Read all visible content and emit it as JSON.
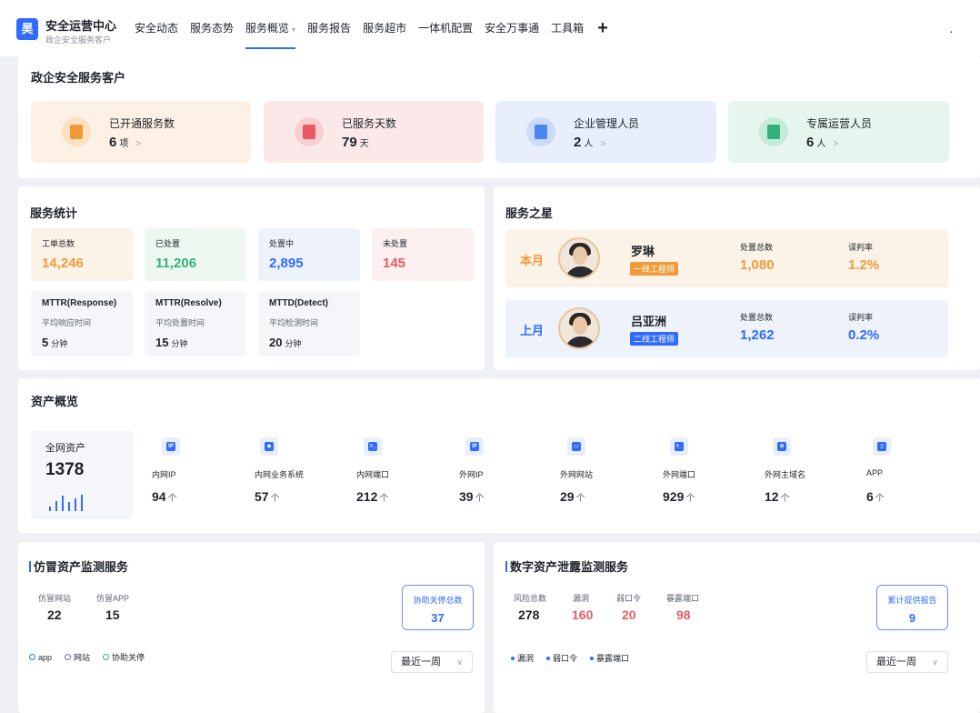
{
  "app": {
    "logo_char": "昊",
    "title": "安全运营中心",
    "subtitle": "政企安全服务客户"
  },
  "nav": {
    "items": [
      "安全动态",
      "服务态势",
      "服务概览",
      "服务报告",
      "服务超市",
      "一体机配置",
      "安全万事通",
      "工具箱"
    ],
    "active_index": 2,
    "active_caret": "▾",
    "plus": "+"
  },
  "customer": {
    "title": "政企安全服务客户",
    "cards": [
      {
        "label": "已开通服务数",
        "value": "6",
        "unit": "项",
        "chevron": ">",
        "bg": "#fcf1e4",
        "icon_bg": "#fce0c0",
        "icon_color": "#f09a3a",
        "icon": "document-icon"
      },
      {
        "label": "已服务天数",
        "value": "79",
        "unit": "天",
        "chevron": "",
        "bg": "#fbe9ea",
        "icon_bg": "#f8cfd1",
        "icon_color": "#e85a63",
        "icon": "calendar-icon"
      },
      {
        "label": "企业管理人员",
        "value": "2",
        "unit": "人",
        "chevron": ">",
        "bg": "#e8eefb",
        "icon_bg": "#cbdaf8",
        "icon_color": "#4a85f0",
        "icon": "user-icon"
      },
      {
        "label": "专属运营人员",
        "value": "6",
        "unit": "人",
        "chevron": ">",
        "bg": "#e6f6ee",
        "icon_bg": "#c5ebd8",
        "icon_color": "#33b07a",
        "icon": "chart-icon"
      }
    ]
  },
  "stats": {
    "title": "服务统计",
    "counts": [
      {
        "label": "工单总数",
        "value": "14,246",
        "color": "#f09a3a",
        "bg": "#fcf3e8"
      },
      {
        "label": "已处置",
        "value": "11,206",
        "color": "#33b07a",
        "bg": "#eef8f1"
      },
      {
        "label": "处置中",
        "value": "2,895",
        "color": "#2f6bff",
        "bg": "#eef2fb"
      },
      {
        "label": "未处置",
        "value": "145",
        "color": "#e85a63",
        "bg": "#fcf0f0"
      }
    ],
    "mttr": [
      {
        "title": "MTTR(Response)",
        "sub": "平均响应时间",
        "value": "5",
        "unit": "分钟"
      },
      {
        "title": "MTTR(Resolve)",
        "sub": "平均处置时间",
        "value": "15",
        "unit": "分钟"
      },
      {
        "title": "MTTD(Detect)",
        "sub": "平均检测时间",
        "value": "20",
        "unit": "分钟"
      }
    ]
  },
  "stars": {
    "title": "服务之星",
    "rows": [
      {
        "period": "本月",
        "name": "罗琳",
        "tag": "一线工程师",
        "tag_color": "#f09a3a",
        "period_color": "#f09a3a",
        "bg": "#fcf3e8",
        "total_label": "处置总数",
        "total": "1,080",
        "rate_label": "误判率",
        "rate": "1.2%",
        "val_color": "#f09a3a"
      },
      {
        "period": "上月",
        "name": "吕亚洲",
        "tag": "二线工程师",
        "tag_color": "#2f6bff",
        "period_color": "#2f6bff",
        "bg": "#eef2fb",
        "total_label": "处置总数",
        "total": "1,262",
        "rate_label": "误判率",
        "rate": "0.2%",
        "val_color": "#2f6bff"
      }
    ]
  },
  "assets": {
    "title": "资产概览",
    "total_label": "全网资产",
    "total": "1378",
    "bar_levels": [
      0.25,
      0.55,
      0.85,
      0.5,
      0.7,
      0.9
    ],
    "items": [
      {
        "name": "内网IP",
        "value": "94",
        "unit": "个",
        "icon": "ip-icon",
        "glyph": "IP"
      },
      {
        "name": "内网业务系统",
        "value": "57",
        "unit": "个",
        "icon": "system-icon",
        "glyph": "◆"
      },
      {
        "name": "内网端口",
        "value": "212",
        "unit": "个",
        "icon": "terminal-icon",
        "glyph": ">_"
      },
      {
        "name": "外网IP",
        "value": "39",
        "unit": "个",
        "icon": "ip-icon",
        "glyph": "IP"
      },
      {
        "name": "外网网站",
        "value": "29",
        "unit": "个",
        "icon": "website-icon",
        "glyph": "▭"
      },
      {
        "name": "外网端口",
        "value": "929",
        "unit": "个",
        "icon": "terminal-icon",
        "glyph": ">_"
      },
      {
        "name": "外网主域名",
        "value": "12",
        "unit": "个",
        "icon": "globe-icon",
        "glyph": "⊕"
      },
      {
        "name": "APP",
        "value": "6",
        "unit": "个",
        "icon": "phone-icon",
        "glyph": "▯"
      }
    ]
  },
  "counterfeit": {
    "title": "仿冒资产监测服务",
    "metrics": [
      {
        "label": "仿冒网站",
        "value": "22"
      },
      {
        "label": "仿冒APP",
        "value": "15"
      }
    ],
    "button": {
      "label": "协助关停总数",
      "value": "37"
    },
    "legend": [
      {
        "label": "app",
        "color": "#2f6bff"
      },
      {
        "label": "网站",
        "color": "#7a5af8"
      },
      {
        "label": "协助关停",
        "color": "#33b07a"
      }
    ],
    "select": {
      "value": "最近一周",
      "arrow": "∨"
    }
  },
  "leak": {
    "title": "数字资产泄露监测服务",
    "metrics": [
      {
        "label": "风险总数",
        "value": "278",
        "color": "#1f2329"
      },
      {
        "label": "漏洞",
        "value": "160",
        "color": "#e85a63"
      },
      {
        "label": "弱口令",
        "value": "20",
        "color": "#e85a63"
      },
      {
        "label": "暴露端口",
        "value": "98",
        "color": "#e85a63"
      }
    ],
    "button": {
      "label": "累计提供报告",
      "value": "9"
    },
    "legend": [
      {
        "label": "漏洞",
        "color": "#2f6bff"
      },
      {
        "label": "弱口令",
        "color": "#2f6bff"
      },
      {
        "label": "暴露端口",
        "color": "#2f6bff"
      }
    ],
    "select": {
      "value": "最近一周",
      "arrow": "∨"
    }
  }
}
